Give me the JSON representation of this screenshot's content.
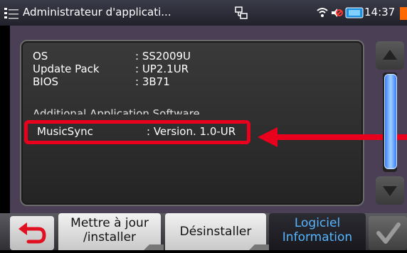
{
  "titlebar": {
    "title": "Administrateur d'applicati...",
    "time": "14:37"
  },
  "info": {
    "rows": [
      {
        "label": "OS",
        "value": ": SS2009U"
      },
      {
        "label": "Update Pack",
        "value": ": UP2.1UR"
      },
      {
        "label": "BIOS",
        "value": ": 3B71"
      }
    ],
    "section_heading": "Additional Application Software",
    "apps": [
      {
        "label": "MusicSync",
        "value": ": Version. 1.0-UR"
      }
    ]
  },
  "bottom": {
    "tab_update_line1": "Mettre à jour",
    "tab_update_line2": "/installer",
    "tab_uninstall": "Désinstaller",
    "tab_info_line1": "Logiciel",
    "tab_info_line2": "Information"
  },
  "colors": {
    "highlight": "#e8001c",
    "active_tab_text": "#56b6ff",
    "frame": "#4a3f55"
  },
  "icons": {
    "menu": "menu-icon",
    "network": "network-icon",
    "back": "back-arrow-icon",
    "ok": "checkmark-icon"
  }
}
